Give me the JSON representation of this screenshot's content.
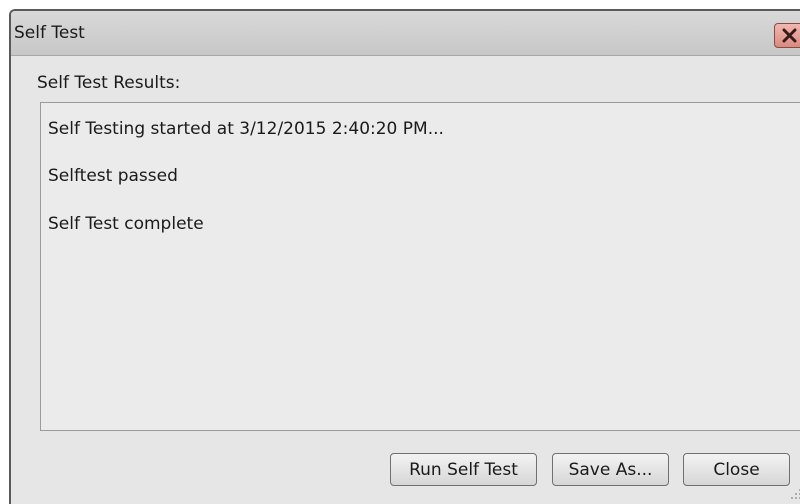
{
  "window": {
    "title": "Self Test"
  },
  "results": {
    "label": "Self Test Results:",
    "lines": [
      "Self Testing started at 3/12/2015 2:40:20 PM...",
      "Selftest passed",
      "Self Test complete"
    ]
  },
  "buttons": {
    "run_label": "Run Self Test",
    "save_label": "Save As...",
    "close_label": "Close"
  },
  "icons": {
    "close": "close-icon",
    "resize": "resize-grip-icon"
  },
  "colors": {
    "close_button": "#d98b80",
    "window_bg": "#e6e6e6"
  }
}
